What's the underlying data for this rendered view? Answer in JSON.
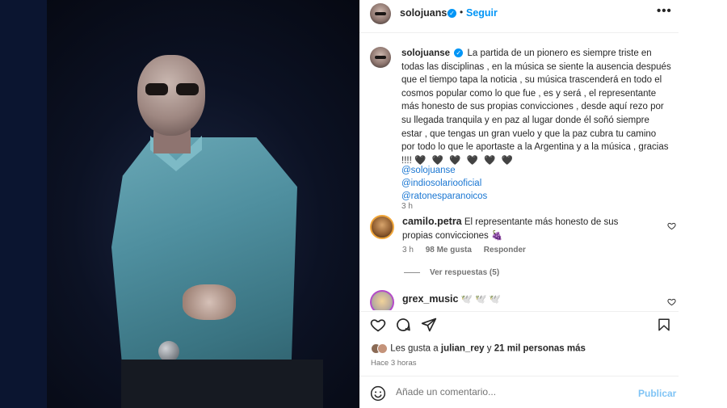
{
  "post": {
    "username": "solojuanse",
    "follow_label": "Seguir",
    "dot": "•",
    "more_label": "•••"
  },
  "caption": {
    "username": "solojuanse",
    "text": "La partida de un pionero es siempre triste en todas las disciplinas , en la música se siente la ausencia después que el tiempo tapa la noticia , su música trascenderá en todo el cosmos popular como lo que fue , es y será , el representante más honesto de sus propias convicciones , desde aquí rezo por su llegada tranquila y en paz al lugar donde él soñó siempre estar , que tengas un gran vuelo y que la paz cubra tu camino por todo lo que le aportaste a la Argentina y a la música , gracias !!!!",
    "hearts": "🖤 🖤 🖤 🖤 🖤 🖤",
    "mentions": [
      "@solojuanse",
      "@indiosolariooficial",
      "@ratonesparanoicos"
    ],
    "time": "3 h"
  },
  "comments": [
    {
      "username": "camilo.petra",
      "text": "El representante más honesto de sus propias convicciones 🍇",
      "time": "3 h",
      "likes": "98 Me gusta",
      "reply": "Responder",
      "view_replies": "Ver respuestas (5)"
    },
    {
      "username": "grex_music",
      "text": "🕊️ 🕊️ 🕊️"
    }
  ],
  "likes": {
    "prefix": "Les gusta a",
    "user": "julian_rey",
    "conj": "y",
    "count": "21 mil personas más"
  },
  "ago": "Hace 3 horas",
  "add_comment": {
    "placeholder": "Añade un comentario...",
    "post_label": "Publicar"
  },
  "colors": {
    "accent": "#0095f6",
    "link": "#00376b",
    "muted": "#737373"
  }
}
